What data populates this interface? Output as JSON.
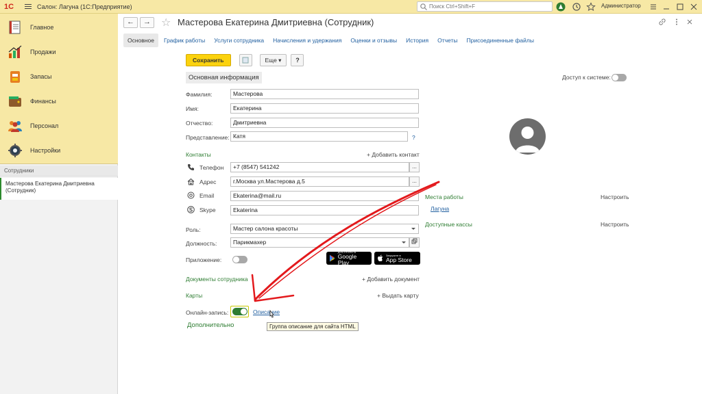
{
  "titlebar": {
    "logo": "1С",
    "title": "Салон: Лагуна  (1С:Предприятие)",
    "search_placeholder": "Поиск Ctrl+Shift+F",
    "user": "Администратор"
  },
  "sidebar": {
    "sections": [
      {
        "label": "Главное",
        "icon": "home-icon"
      },
      {
        "label": "Продажи",
        "icon": "sales-chart-icon"
      },
      {
        "label": "Запасы",
        "icon": "stock-icon"
      },
      {
        "label": "Финансы",
        "icon": "wallet-icon"
      },
      {
        "label": "Персонал",
        "icon": "people-icon"
      },
      {
        "label": "Настройки",
        "icon": "gear-icon"
      }
    ],
    "open_windows_label": "Сотрудники",
    "open_item": "Мастерова Екатерина Дмитриевна (Сотрудник)"
  },
  "form": {
    "title": "Мастерова Екатерина Дмитриевна (Сотрудник)",
    "tabs": [
      "Основное",
      "График работы",
      "Услуги сотрудника",
      "Начисления и удержания",
      "Оценки и отзывы",
      "История",
      "Отчеты",
      "Присоединенные файлы"
    ],
    "toolbar": {
      "save": "Сохранить",
      "more": "Еще",
      "help": "?"
    },
    "group_header": "Основная информация",
    "access_label": "Доступ к системе:",
    "fields": {
      "surname": {
        "label": "Фамилия:",
        "value": "Мастерова"
      },
      "name": {
        "label": "Имя:",
        "value": "Екатерина"
      },
      "patronymic": {
        "label": "Отчество:",
        "value": "Дмитриевна"
      },
      "display": {
        "label": "Представление:",
        "value": "Катя"
      }
    },
    "help_mark": "?",
    "contacts": {
      "label": "Контакты",
      "add": "+ Добавить контакт",
      "items": {
        "phone": {
          "label": "Телефон",
          "value": "+7 (8547) 541242"
        },
        "address": {
          "label": "Адрес",
          "value": "г.Москва ул.Мастерова д.5"
        },
        "email": {
          "label": "Email",
          "value": "Ekaterina@mail.ru"
        },
        "skype": {
          "label": "Skype",
          "value": "Ekaterina"
        }
      }
    },
    "role": {
      "label": "Роль:",
      "value": "Мастер салона красоты"
    },
    "position": {
      "label": "Должность:",
      "value": "Парикмахер"
    },
    "app": {
      "label": "Приложение:",
      "google_small": "ДОСТУПНО В",
      "google_big": "Google Play",
      "apple_small": "Загрузите в",
      "apple_big": "App Store"
    },
    "documents": {
      "label": "Документы сотрудника",
      "add": "+ Добавить документ"
    },
    "cards": {
      "label": "Карты",
      "add": "+ Выдать карту"
    },
    "online": {
      "label": "Онлайн-запись:",
      "link": "Описание",
      "tooltip": "Группа описание для сайта HTML"
    },
    "additional": "Дополнительно",
    "workplaces": {
      "label": "Места работы",
      "configure": "Настроить",
      "value": "Лагуна"
    },
    "cashboxes": {
      "label": "Доступные кассы",
      "configure": "Настроить"
    }
  },
  "colors": {
    "titlebar_bg": "#f7e8a5",
    "accent_green": "#2e7d32",
    "link_blue": "#1f5e9f",
    "save_yellow": "#fbd20e",
    "annotation_red": "#e3191c"
  }
}
